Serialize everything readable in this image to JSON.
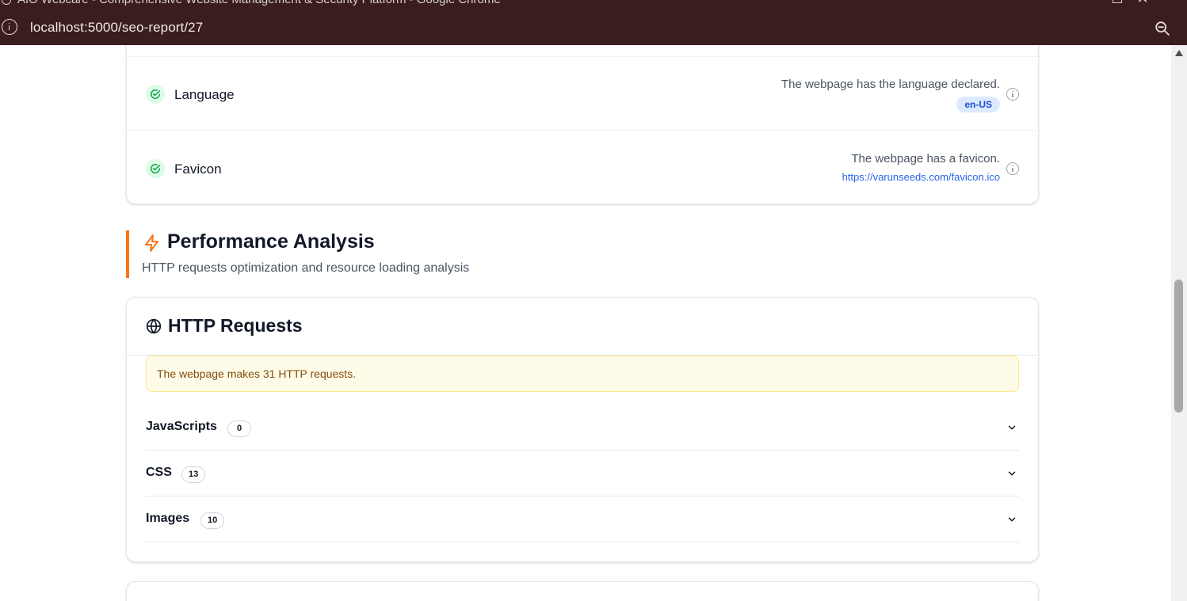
{
  "browser": {
    "window_title": "AIO Webcare - Comprehensive Website Management & Security Platform - Google Chrome",
    "url": "localhost:5000/seo-report/27"
  },
  "checks": [
    {
      "label": "Language",
      "description": "The webpage has the language declared.",
      "value": "en-US",
      "status": "pass"
    },
    {
      "label": "Favicon",
      "description": "The webpage has a favicon.",
      "value": "https://varunseeds.com/favicon.ico",
      "status": "pass"
    }
  ],
  "performance": {
    "title": "Performance Analysis",
    "subtitle": "HTTP requests optimization and resource loading analysis",
    "accent_color": "#f97316"
  },
  "http": {
    "title": "HTTP Requests",
    "notice": "The webpage makes 31 HTTP requests.",
    "groups": [
      {
        "label": "JavaScripts",
        "count": "0"
      },
      {
        "label": "CSS",
        "count": "13"
      },
      {
        "label": "Images",
        "count": "10"
      }
    ]
  },
  "colors": {
    "browser_chrome": "#3a1d1d",
    "pass_green": "#16a34a",
    "link_blue": "#2563eb",
    "notice_bg": "#fefce8"
  }
}
